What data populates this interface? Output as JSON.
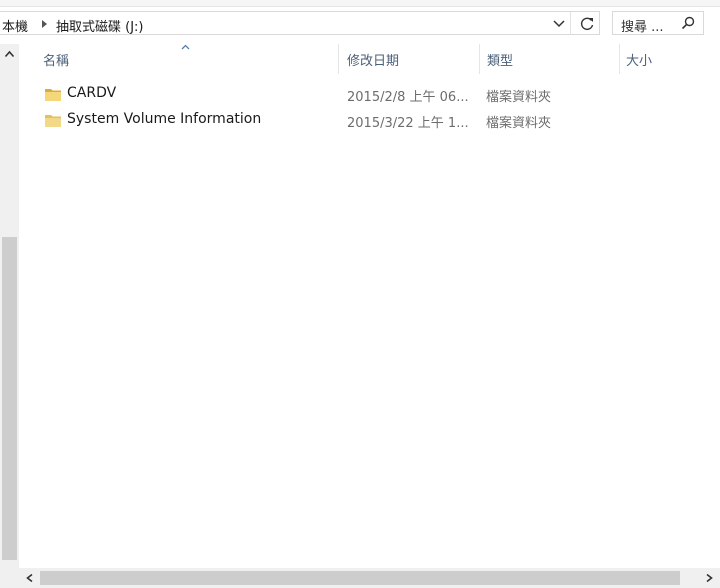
{
  "breadcrumb": {
    "items": [
      "本機",
      "抽取式磁碟 (J:)"
    ]
  },
  "search": {
    "placeholder": "搜尋 ..."
  },
  "columns": {
    "name": "名稱",
    "date": "修改日期",
    "type": "類型",
    "size": "大小"
  },
  "files": [
    {
      "name": "CARDV",
      "date": "2015/2/8 上午 06...",
      "type": "檔案資料夾",
      "size": ""
    },
    {
      "name": "System Volume Information",
      "date": "2015/3/22 上午 1...",
      "type": "檔案資料夾",
      "size": ""
    }
  ],
  "icons": {
    "folder": "folder-icon",
    "refresh": "refresh-icon",
    "search": "search-icon",
    "dropdown": "chevron-down-icon",
    "sort": "sort-ascending-icon"
  },
  "colors": {
    "folder": "#e8c45a",
    "header_text": "#4c607a",
    "scrollbar_thumb": "#cdcdcd"
  }
}
